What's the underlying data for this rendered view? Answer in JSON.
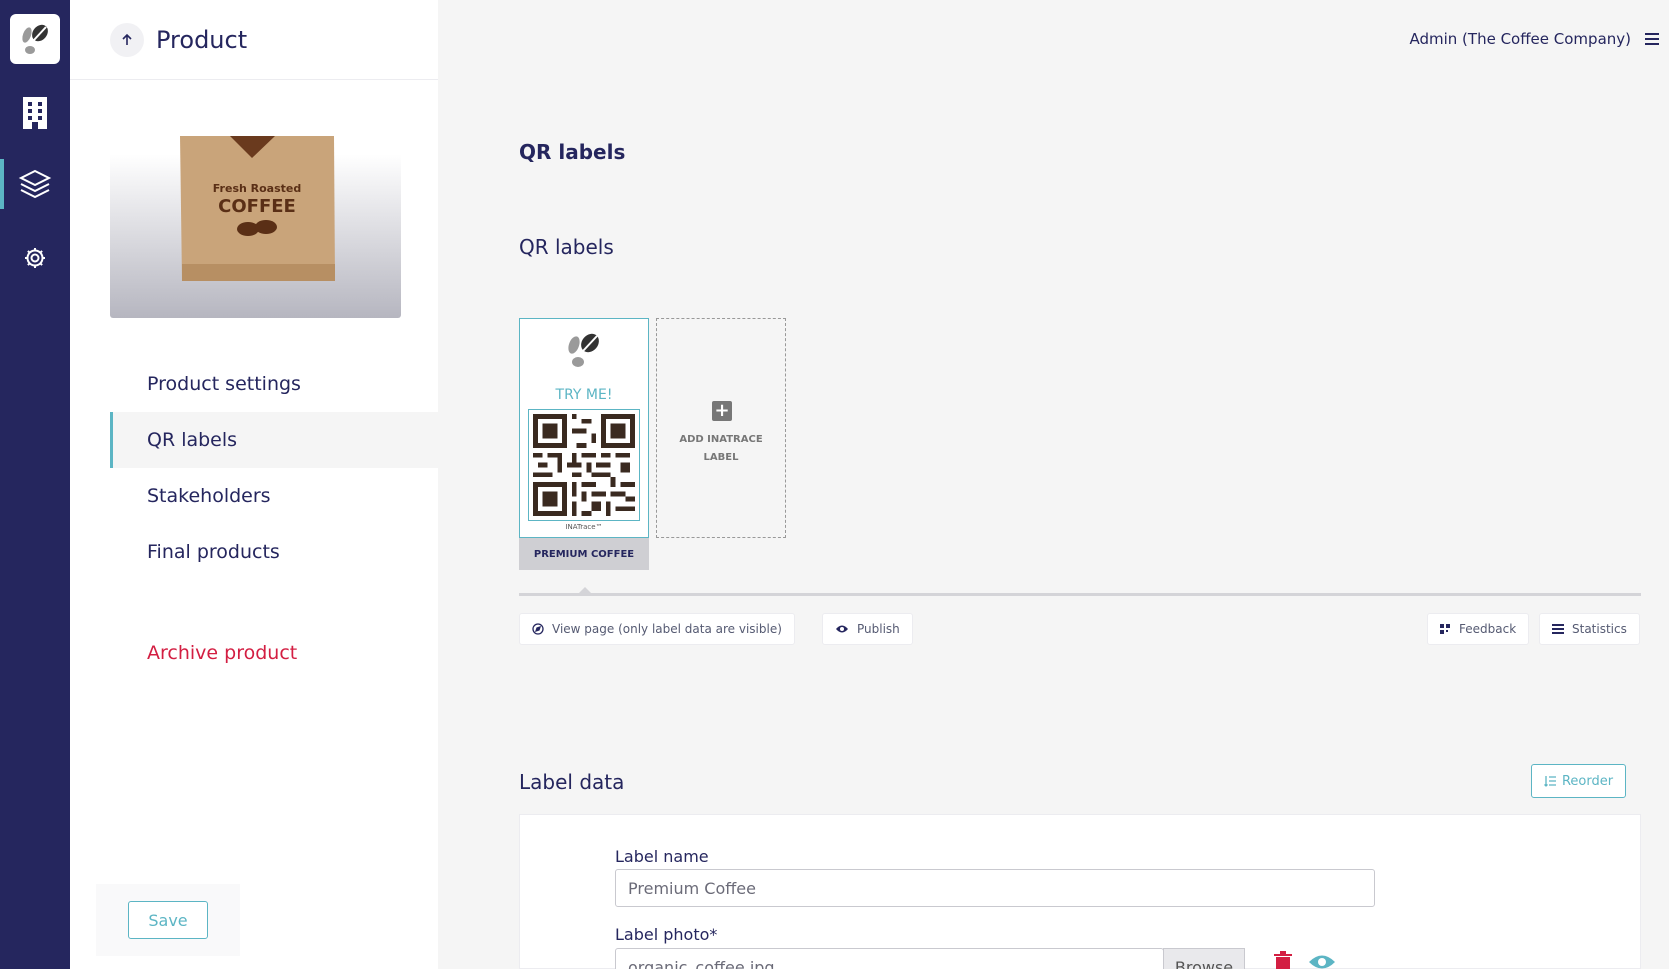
{
  "sidebar": {
    "title": "Product",
    "menu": [
      "Product settings",
      "QR labels",
      "Stakeholders",
      "Final products"
    ],
    "archive_label": "Archive product",
    "save_label": "Save"
  },
  "header": {
    "user": "Admin (The Coffee Company)"
  },
  "main": {
    "section_title": "QR labels",
    "subsection_title": "QR labels",
    "label_card": {
      "try_text": "TRY ME!",
      "brand": "INATrace™",
      "name": "PREMIUM COFFEE"
    },
    "add_card": {
      "line1": "ADD INATRACE",
      "line2": "LABEL"
    },
    "actions": {
      "view_page": "View page (only label data are visible)",
      "publish": "Publish",
      "feedback": "Feedback",
      "statistics": "Statistics"
    },
    "label_data": {
      "title": "Label data",
      "reorder": "Reorder",
      "name_label": "Label name",
      "name_value": "Premium Coffee",
      "photo_label": "Label photo*",
      "photo_value": "organic_coffee.jpg",
      "browse": "Browse"
    }
  },
  "colors": {
    "rail": "#25265e",
    "accent": "#5cb5c4",
    "danger": "#d31e42"
  }
}
